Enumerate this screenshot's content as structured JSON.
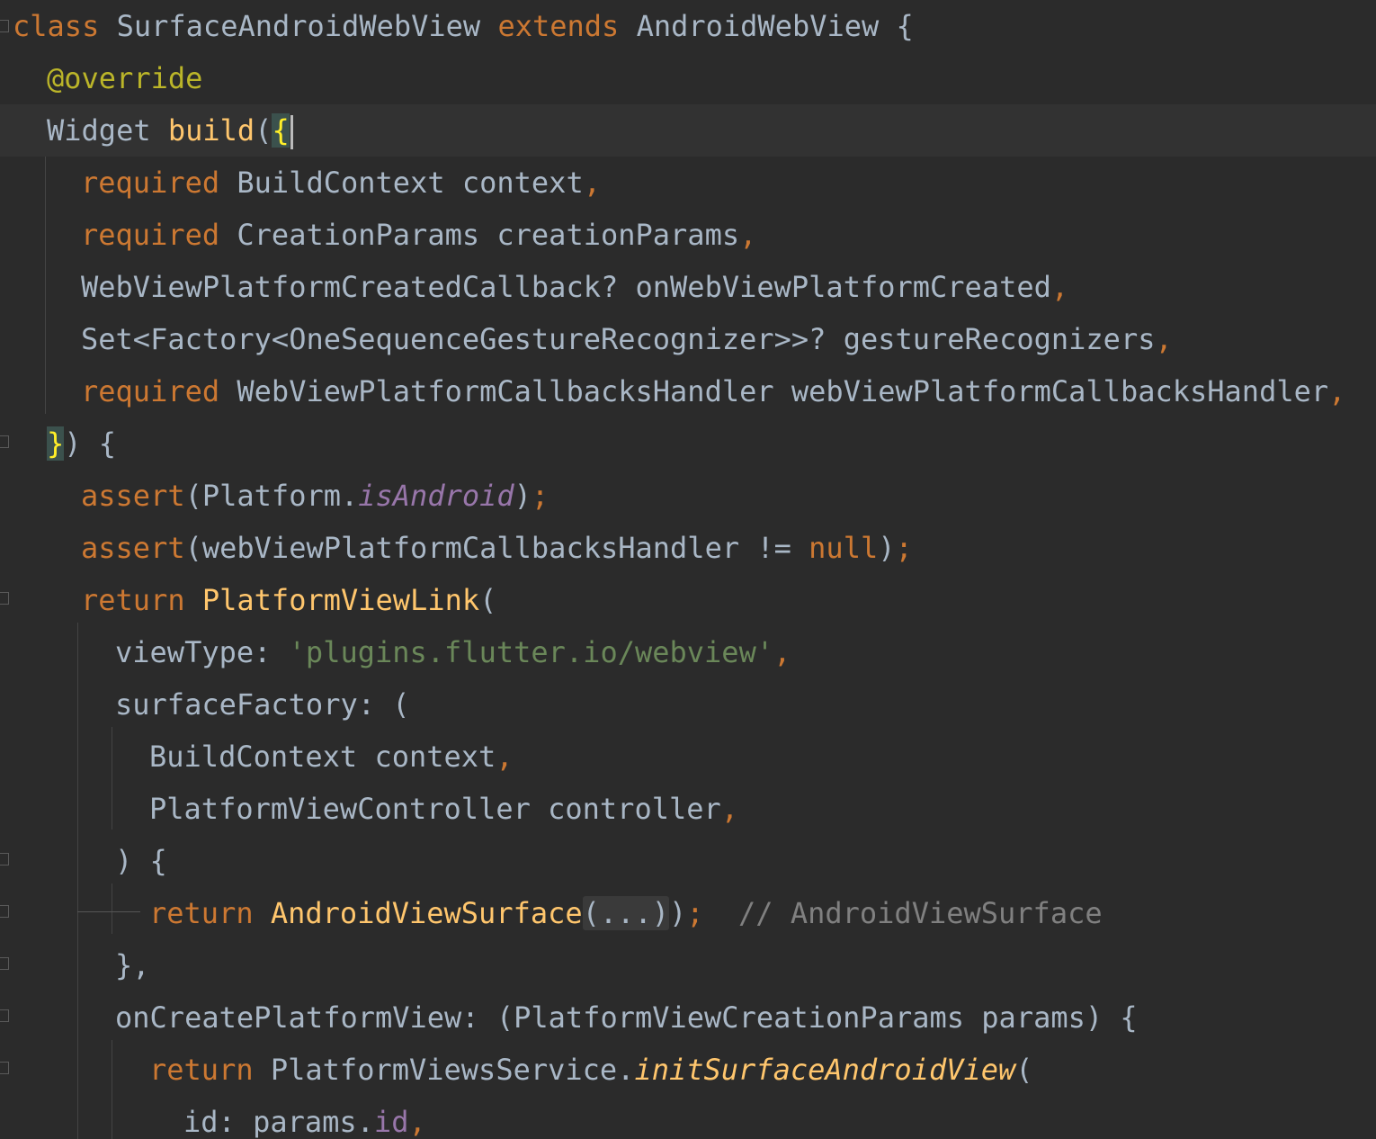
{
  "editor": {
    "background": "#2b2b2b",
    "current_line_background": "#323232",
    "lines": [
      {
        "k": "class",
        "s1": " ",
        "cls": "SurfaceAndroidWebView",
        "s2": " ",
        "ext": "extends",
        "s3": " ",
        "base": "AndroidWebView",
        "tail": " {"
      },
      {
        "ann": "@override"
      },
      {
        "t1": "Widget ",
        "fn": "build",
        "t2": "(",
        "brace": "{"
      },
      {
        "kw": "required",
        "t": " BuildContext context",
        "p": ","
      },
      {
        "kw": "required",
        "t": " CreationParams creationParams",
        "p": ","
      },
      {
        "t": "WebViewPlatformCreatedCallback? onWebViewPlatformCreated",
        "p": ","
      },
      {
        "t": "Set<Factory<OneSequenceGestureRecognizer>>? gestureRecognizers",
        "p": ","
      },
      {
        "kw": "required",
        "t": " WebViewPlatformCallbacksHandler webViewPlatformCallbacksHandler",
        "p": ","
      },
      {
        "brace": "}",
        "t": ") {"
      },
      {
        "fn": "assert",
        "t1": "(Platform.",
        "prop": "isAndroid",
        "t2": ")",
        "p": ";"
      },
      {
        "fn": "assert",
        "t1": "(webViewPlatformCallbacksHandler != ",
        "kw": "null",
        "t2": ")",
        "p": ";"
      },
      {
        "kw": "return",
        "s": " ",
        "fn": "PlatformViewLink",
        "t": "("
      },
      {
        "t": "viewType: ",
        "str": "'plugins.flutter.io/webview'",
        "p": ","
      },
      {
        "t": "surfaceFactory: ("
      },
      {
        "t": "BuildContext context",
        "p": ","
      },
      {
        "t": "PlatformViewController controller",
        "p": ","
      },
      {
        "t": ") {"
      },
      {
        "kw": "return",
        "s": " ",
        "fn": "AndroidViewSurface",
        "fold": "(...)",
        "t": ")",
        "p": ";",
        "cm": "  // AndroidViewSurface"
      },
      {
        "t": "},"
      },
      {
        "t": "onCreatePlatformView: (PlatformViewCreationParams params) {"
      },
      {
        "kw": "return",
        "t1": " PlatformViewsService.",
        "ifn": "initSurfaceAndroidView",
        "t2": "("
      },
      {
        "t1": "id: params.",
        "propn": "id",
        "p": ","
      }
    ]
  }
}
